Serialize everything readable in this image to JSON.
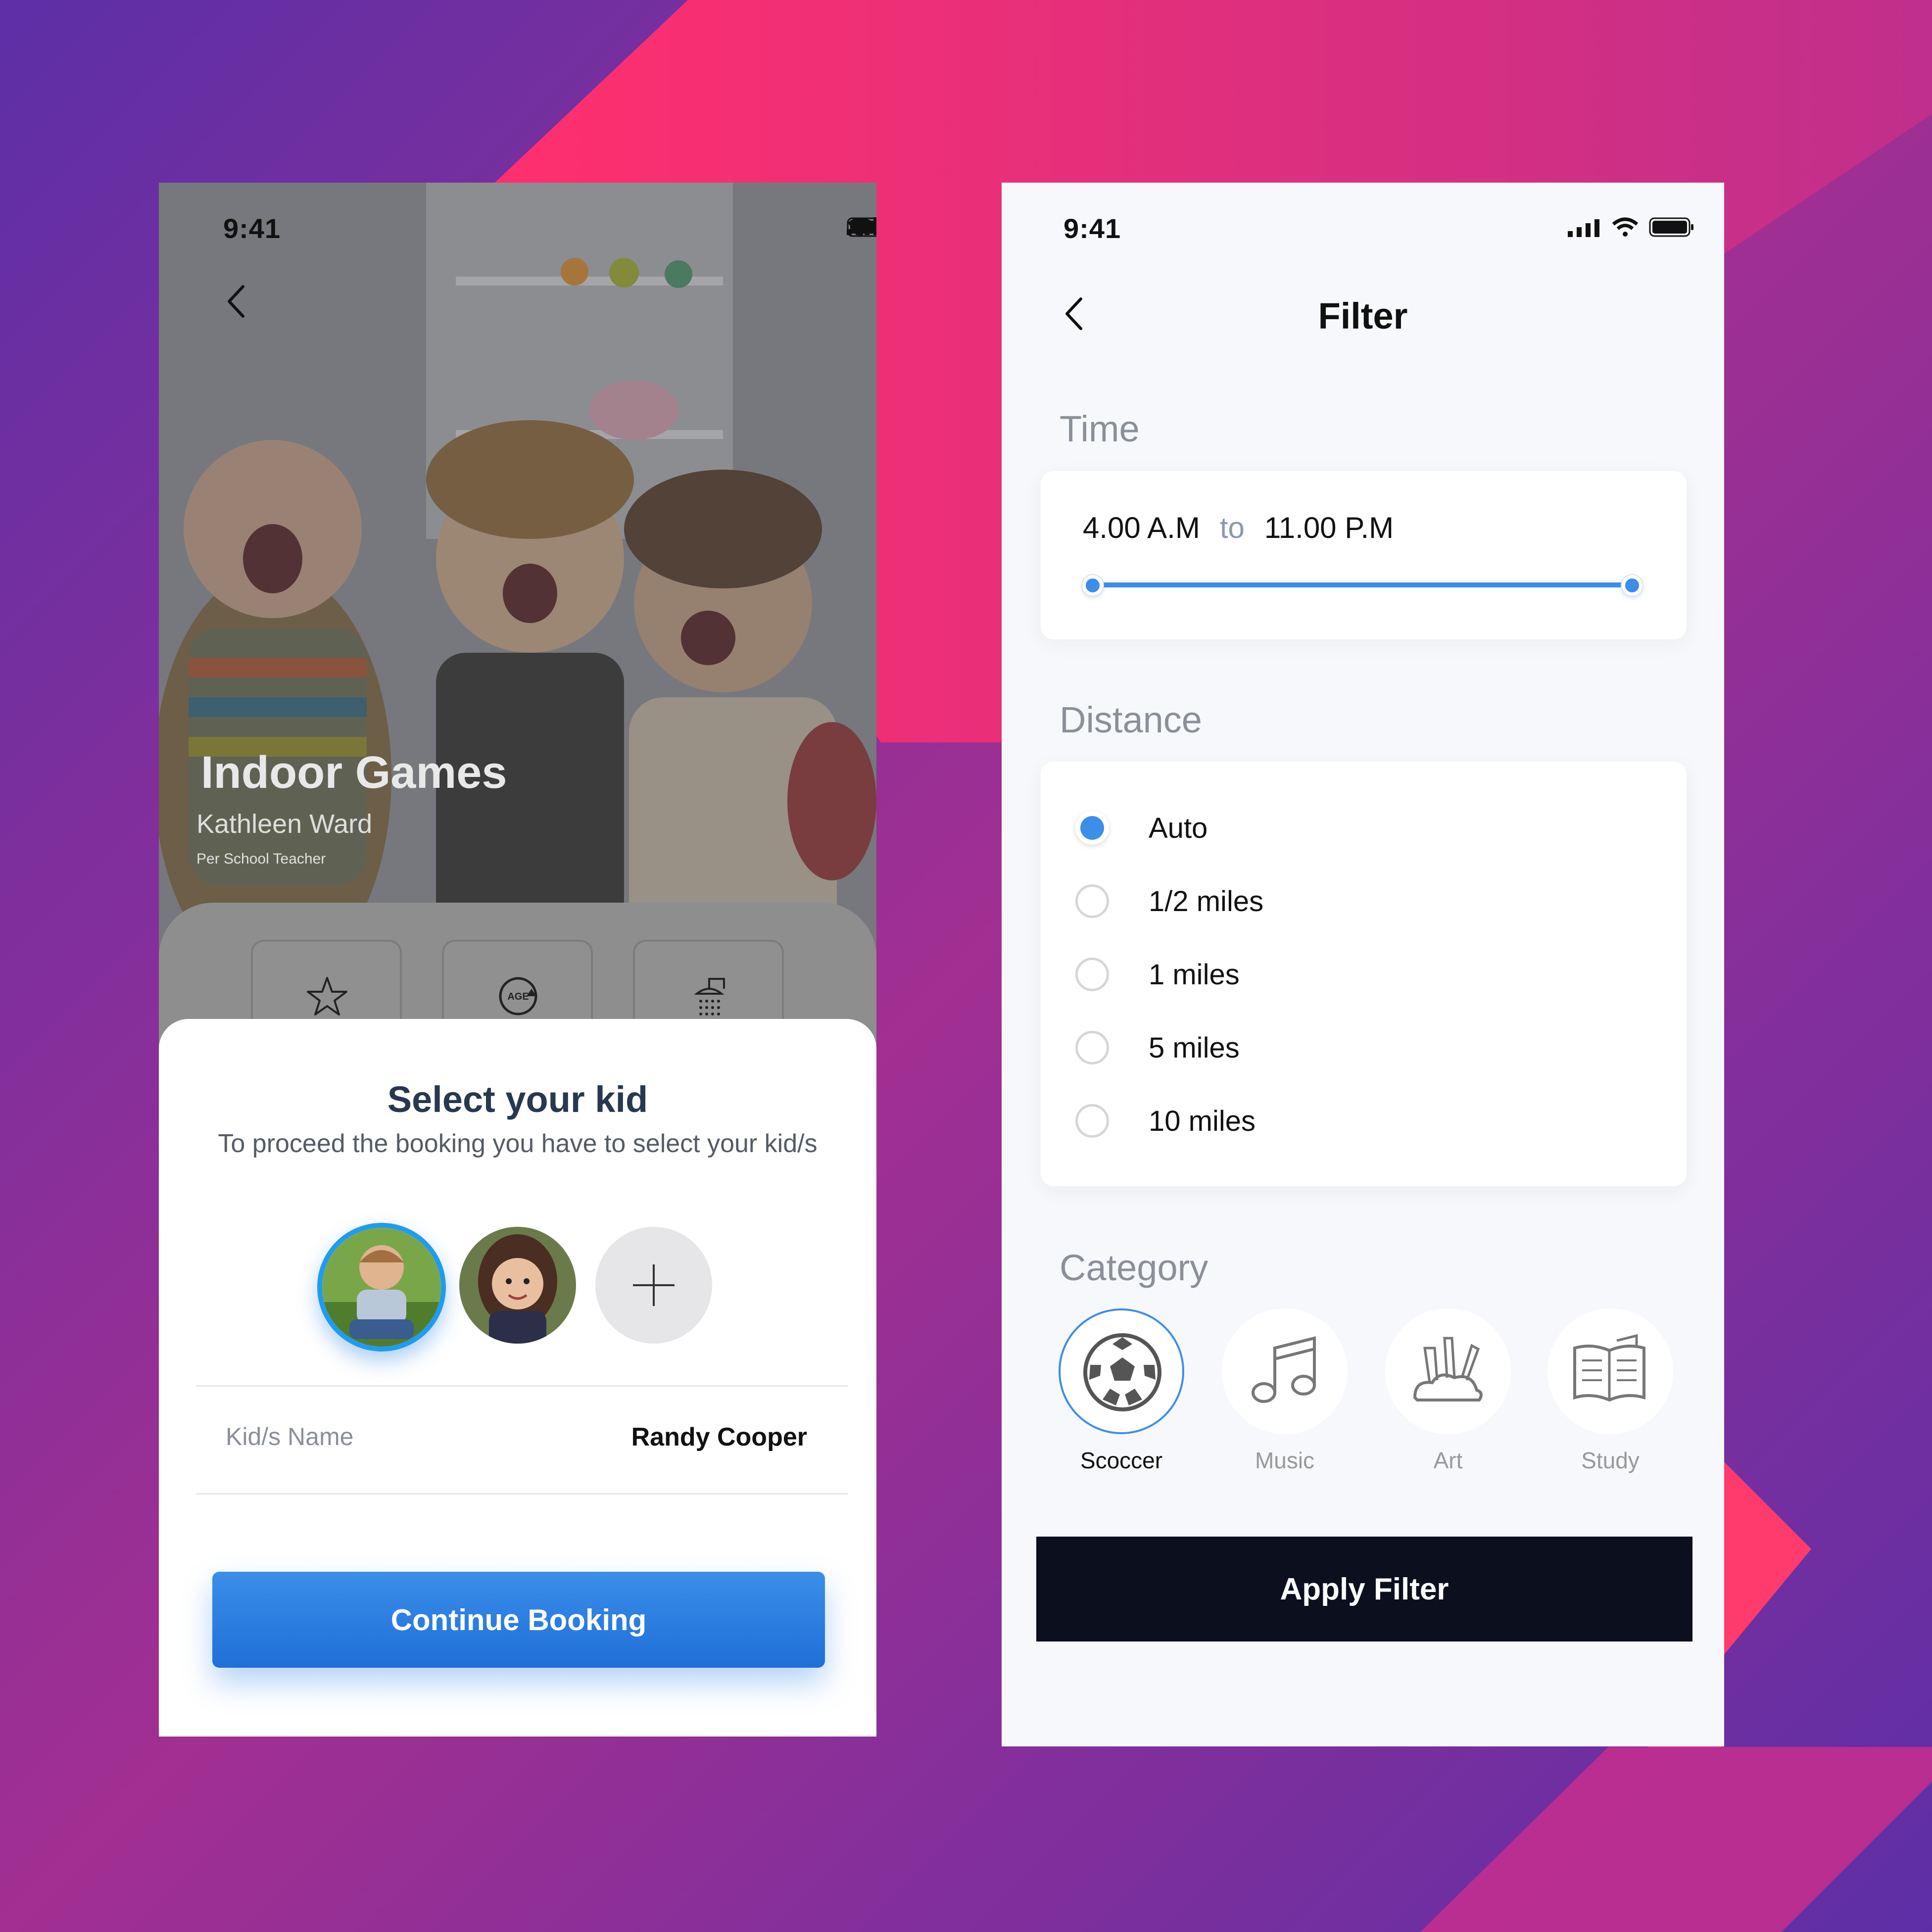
{
  "left": {
    "status": {
      "time": "9:41"
    },
    "hero": {
      "title": "Indoor Games",
      "teacher_name": "Kathleen Ward",
      "teacher_role": "Per School Teacher"
    },
    "features": [
      {
        "icon": "star-icon"
      },
      {
        "icon": "age-icon"
      },
      {
        "icon": "shower-icon"
      }
    ],
    "sheet": {
      "title": "Select your kid",
      "subtitle": "To proceed the booking you have to select your kid/s",
      "kid_name_label": "Kid/s Name",
      "kid_name_value": "Randy Cooper",
      "continue_label": "Continue Booking"
    }
  },
  "right": {
    "status": {
      "time": "9:41"
    },
    "header": {
      "title": "Filter"
    },
    "time": {
      "label": "Time",
      "from": "4.00 A.M",
      "to_word": "to",
      "to": "11.00 P.M",
      "range_fraction": [
        0,
        1
      ]
    },
    "distance": {
      "label": "Distance",
      "options": [
        "Auto",
        "1/2 miles",
        "1 miles",
        "5 miles",
        "10 miles"
      ],
      "selected": "Auto"
    },
    "category": {
      "label": "Category",
      "items": [
        {
          "label": "Scoccer",
          "icon": "soccer-ball-icon",
          "selected": true
        },
        {
          "label": "Music",
          "icon": "music-note-icon",
          "selected": false
        },
        {
          "label": "Art",
          "icon": "art-supplies-icon",
          "selected": false
        },
        {
          "label": "Study",
          "icon": "open-book-icon",
          "selected": false
        }
      ]
    },
    "apply_label": "Apply Filter"
  },
  "colors": {
    "accent": "#3b8ee9",
    "dark_button": "#0b0f1e",
    "bg_purple": "#6a2fa8",
    "bg_pink": "#ff3070"
  }
}
